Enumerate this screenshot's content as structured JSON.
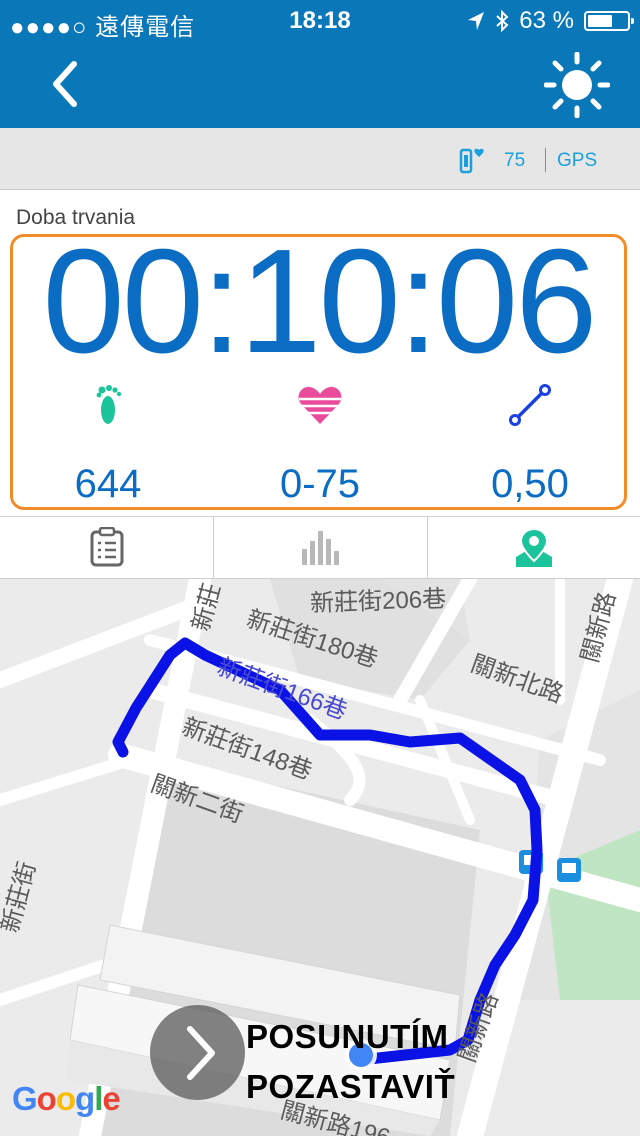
{
  "status": {
    "carrier": "●●●●○ 遠傳電信",
    "time": "18:18",
    "battery_text": "63 %",
    "battery_level": 0.63
  },
  "header": {
    "back_icon": "chevron-left-icon",
    "brightness_icon": "sun-icon"
  },
  "infobar": {
    "heart_rate": "75",
    "gps_label": "GPS"
  },
  "main": {
    "duration_label": "Doba trvania",
    "duration": "00:10:06",
    "stats": [
      {
        "icon": "footprint-icon",
        "value": "644"
      },
      {
        "icon": "heart-zone-icon",
        "value": "0-75"
      },
      {
        "icon": "distance-icon",
        "value": "0,50"
      }
    ]
  },
  "tabs": [
    {
      "icon": "clipboard-list-icon"
    },
    {
      "icon": "bar-chart-icon"
    },
    {
      "icon": "map-pin-icon",
      "active": true
    }
  ],
  "map": {
    "labels": [
      "新莊街206巷",
      "新莊街180巷",
      "新莊街166巷",
      "新莊街148巷",
      "關新二街",
      "關新北路",
      "新莊街",
      "關新路",
      "關新路196",
      "新莊",
      "關新路"
    ],
    "route_color": "#0a12e6"
  },
  "slider": {
    "line1": "POSUNUTÍM",
    "line2": "POZASTAVIŤ"
  },
  "google_logo": "Google",
  "colors": {
    "header_bg": "#0a78b8",
    "accent_blue": "#0a6cc3",
    "outline_orange": "#f28c28",
    "active_tab": "#1bc49a"
  }
}
